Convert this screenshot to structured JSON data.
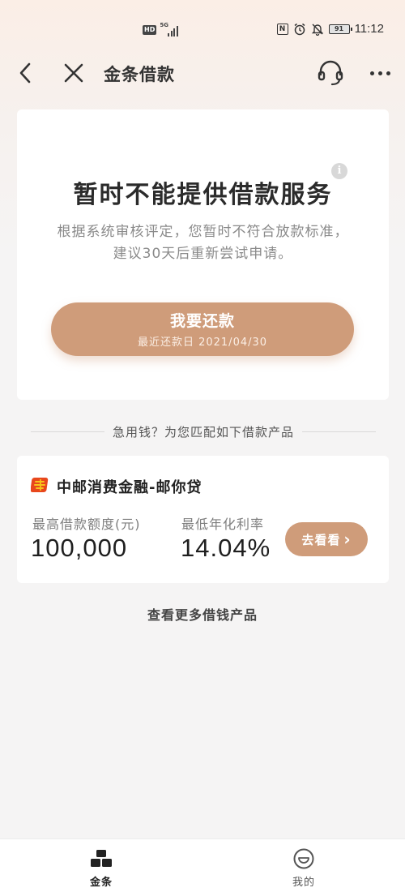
{
  "status_bar": {
    "hd": "HD",
    "network": "5G",
    "nfc": "N",
    "battery": "91",
    "time": "11:12"
  },
  "nav": {
    "title": "金条借款"
  },
  "status_card": {
    "title": "暂时不能提供借款服务",
    "desc_line1": "根据系统审核评定，您暂时不符合放款标准，",
    "desc_line2": "建议30天后重新尝试申请。",
    "info_icon": "i",
    "repay_label": "我要还款",
    "repay_date": "最近还款日 2021/04/30"
  },
  "recommend": {
    "divider_text": "急用钱？为您匹配如下借款产品",
    "product": {
      "name": "中邮消费金融-邮你贷",
      "amount_label": "最高借款额度(元)",
      "amount": "100,000",
      "rate_label": "最低年化利率",
      "rate": "14.04%",
      "button": "去看看",
      "button_icon": "›"
    },
    "more_link": "查看更多借钱产品"
  },
  "tabbar": {
    "tabs": [
      {
        "label": "金条",
        "icon": "bars-stack-icon",
        "active": true
      },
      {
        "label": "我的",
        "icon": "smile-face-icon",
        "active": false
      }
    ]
  },
  "colors": {
    "accent": "#cf9c7a",
    "background": "#f5f4f4",
    "header_tint": "#fbeee6"
  }
}
